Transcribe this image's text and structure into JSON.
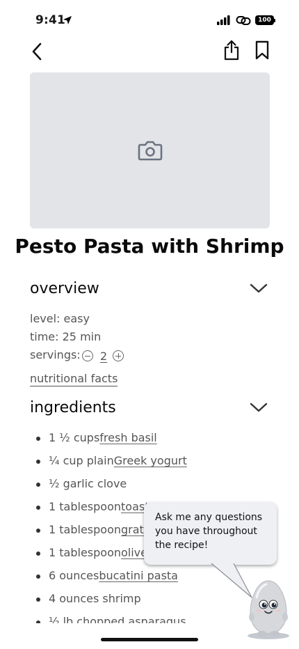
{
  "status_bar": {
    "time": "9:41",
    "battery": "100"
  },
  "recipe": {
    "title": "Pesto Pasta with Shrimp"
  },
  "overview": {
    "heading": "overview",
    "level": "level: easy",
    "time": "time: 25 min",
    "servings_label": "servings:",
    "servings_value": "2",
    "nutrition_link": "nutritional facts"
  },
  "ingredients": {
    "heading": "ingredients",
    "items": [
      {
        "prefix": "1 ½ cups ",
        "link": "fresh basil",
        "suffix": ""
      },
      {
        "prefix": "¼ cup plain ",
        "link": "Greek yogurt",
        "suffix": ""
      },
      {
        "prefix": "½ garlic clove",
        "link": "",
        "suffix": ""
      },
      {
        "prefix": "1 tablespoon ",
        "link": "toast",
        "suffix": ""
      },
      {
        "prefix": "1 tablespoon ",
        "link": "grate",
        "suffix": ""
      },
      {
        "prefix": "1 tablespoon ",
        "link": "olive",
        "suffix": ""
      },
      {
        "prefix": "6 ounces ",
        "link": "bucatini pasta",
        "suffix": ""
      },
      {
        "prefix": "4 ounces shrimp",
        "link": "",
        "suffix": ""
      },
      {
        "prefix": "½ lb chopped asparagus",
        "link": "",
        "suffix": ""
      }
    ]
  },
  "assistant": {
    "bubble_text": "Ask me any questions you have throughout the recipe!"
  },
  "icons": {
    "back": "chevron-left-icon",
    "share": "share-icon",
    "bookmark": "bookmark-icon",
    "photo": "camera-icon",
    "collapse": "chevron-down-icon"
  },
  "colors": {
    "photo_bg": "#e2e4e8",
    "bubble_bg": "#eef0f4",
    "camera": "#6b7280"
  }
}
